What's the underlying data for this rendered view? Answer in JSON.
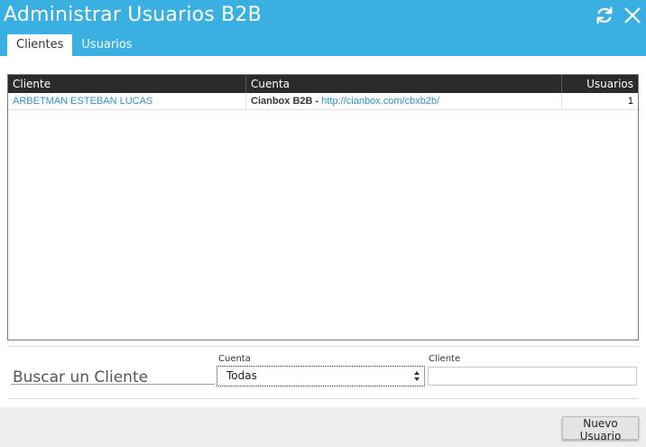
{
  "window": {
    "title": "Administrar Usuarios B2B",
    "refresh_icon": "refresh-icon",
    "close_icon": "close-icon"
  },
  "tabs": [
    {
      "label": "Clientes",
      "active": true
    },
    {
      "label": "Usuarios",
      "active": false
    }
  ],
  "grid": {
    "columns": [
      "Cliente",
      "Cuenta",
      "Usuarios"
    ],
    "rows": [
      {
        "cliente": "ARBETMAN ESTEBAN LUCAS",
        "cuenta_nombre": "Cianbox B2B",
        "cuenta_sep": " - ",
        "cuenta_url": "http://cianbox.com/cbxb2b/",
        "usuarios": "1"
      }
    ]
  },
  "search": {
    "title": "Buscar un Cliente",
    "cuenta_label": "Cuenta",
    "cuenta_value": "Todas",
    "cliente_label": "Cliente",
    "cliente_value": ""
  },
  "footer": {
    "new_user_label": "Nuevo Usuario"
  },
  "colors": {
    "header": "#3ab0e2",
    "grid_header": "#2b2b2b",
    "link": "#2b93c8"
  }
}
